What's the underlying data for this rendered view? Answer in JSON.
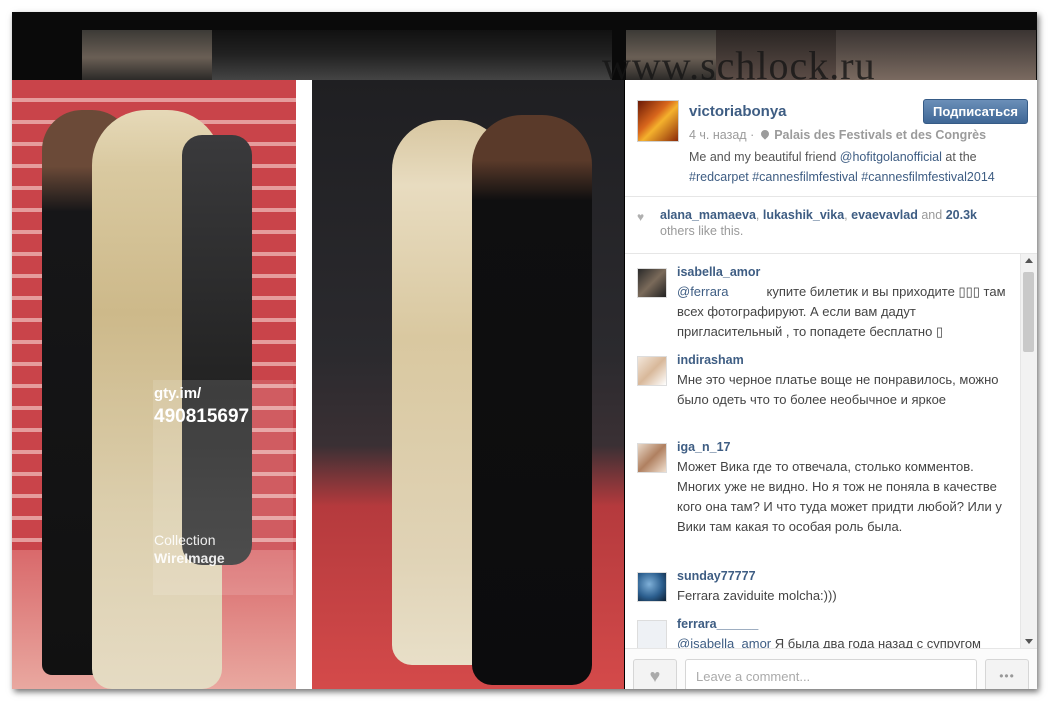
{
  "watermark": "www.schlock.ru",
  "photo": {
    "getty_site": "gty.im/",
    "getty_id": "490815697",
    "collection_label": "Collection",
    "collection_name": "WireImage"
  },
  "post": {
    "username": "victoriabonya",
    "follow_label": "Подписаться",
    "time_ago": "4 ч. назад",
    "location": "Palais des Festivals et des Congrès",
    "caption_prefix": "Me and my beautiful friend ",
    "caption_mention": "@hofitgolanofficial",
    "caption_middle": " at the",
    "caption_tags": "#redcarpet #cannesfilmfestival #cannesfilmfestival2014"
  },
  "likes": {
    "users": [
      "alana_mamaeva",
      "lukashik_vika",
      "evaevavlad"
    ],
    "separator": ", ",
    "and": "and",
    "count": "20.3k",
    "others": "others like this."
  },
  "comments": [
    {
      "user": "isabella_amor",
      "mention": "@ferrara",
      "text": "купите билетик и вы приходите ▯▯▯ там всех фотографируют. А если вам дадут пригласительный , то попадете бесплатно ▯"
    },
    {
      "user": "indirasham",
      "text": "Мне это черное платье воще не понравилось, можно было одеть что то более необычное и яркое"
    },
    {
      "user": "iga_n_17",
      "text": "Может Вика где то отвечала, столько комментов. Многих уже не видно. Но я тож не поняла в качестве кого она там? И что туда может придти любой? Или у Вики там какая то особая роль была."
    },
    {
      "user": "sunday77777",
      "text": "Ferrara zaviduite molcha:)))"
    },
    {
      "user": "ferrara______",
      "mention": "@isabella_amor",
      "text": " Я была два года назад с супругом"
    }
  ],
  "footer": {
    "comment_placeholder": "Leave a comment...",
    "more_label": "•••"
  }
}
